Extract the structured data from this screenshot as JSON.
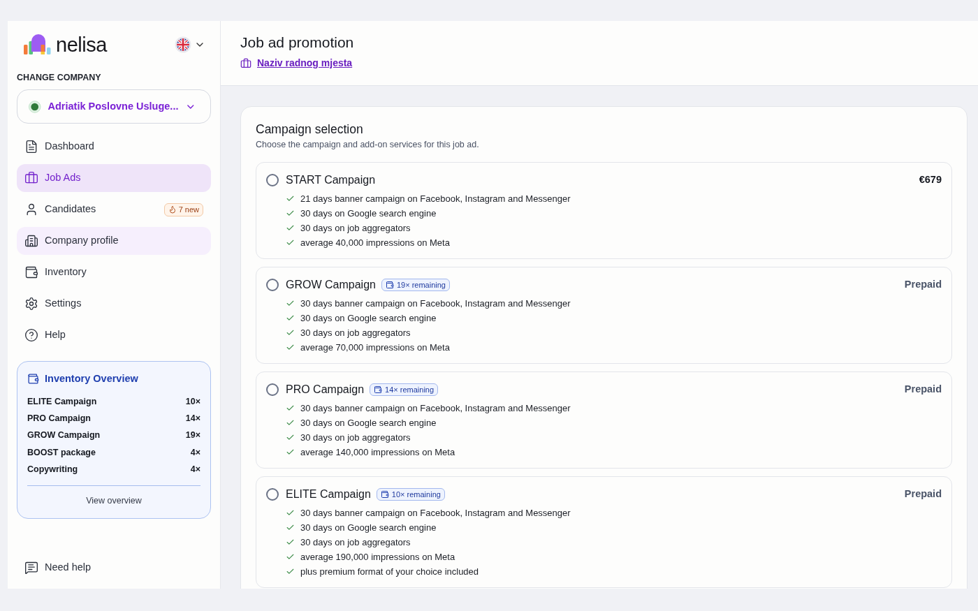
{
  "brand": {
    "name": "nelisa"
  },
  "company_switcher": {
    "label": "CHANGE COMPANY",
    "company": "Adriatik Poslovne Usluge..."
  },
  "nav": [
    {
      "label": "Dashboard",
      "selected": false,
      "hovered": false
    },
    {
      "label": "Job Ads",
      "selected": true,
      "hovered": false
    },
    {
      "label": "Candidates",
      "selected": false,
      "hovered": false,
      "badge": "7 new"
    },
    {
      "label": "Company profile",
      "selected": false,
      "hovered": true
    },
    {
      "label": "Inventory",
      "selected": false,
      "hovered": false
    },
    {
      "label": "Settings",
      "selected": false,
      "hovered": false
    },
    {
      "label": "Help",
      "selected": false,
      "hovered": false
    }
  ],
  "inventory_overview": {
    "title": "Inventory Overview",
    "items": [
      {
        "name": "ELITE Campaign",
        "count": "10×"
      },
      {
        "name": "PRO Campaign",
        "count": "14×"
      },
      {
        "name": "GROW Campaign",
        "count": "19×"
      },
      {
        "name": "BOOST package",
        "count": "4×"
      },
      {
        "name": "Copywriting",
        "count": "4×"
      }
    ],
    "action": "View overview"
  },
  "support": {
    "label": "Need help"
  },
  "header": {
    "title": "Job ad promotion",
    "job_link": "Naziv radnog mjesta"
  },
  "campaign_selection": {
    "title": "Campaign selection",
    "subtitle": "Choose the campaign and add-on services for this job ad.",
    "options": [
      {
        "name": "START Campaign",
        "kind": "paid",
        "selected": false,
        "price": "€679",
        "features": [
          "21 days banner campaign on Facebook, Instagram and Messenger",
          "30 days on Google search engine",
          "30 days on job aggregators",
          "average 40,000 impressions on Meta"
        ]
      },
      {
        "name": "GROW Campaign",
        "kind": "prepaid",
        "selected": false,
        "remaining": "19× remaining",
        "price": "Prepaid",
        "features": [
          "30 days banner campaign on Facebook, Instagram and Messenger",
          "30 days on Google search engine",
          "30 days on job aggregators",
          "average 70,000 impressions on Meta"
        ]
      },
      {
        "name": "PRO Campaign",
        "kind": "prepaid",
        "selected": false,
        "remaining": "14× remaining",
        "price": "Prepaid",
        "features": [
          "30 days banner campaign on Facebook, Instagram and Messenger",
          "30 days on Google search engine",
          "30 days on job aggregators",
          "average 140,000 impressions on Meta"
        ]
      },
      {
        "name": "ELITE Campaign",
        "kind": "prepaid",
        "selected": false,
        "remaining": "10× remaining",
        "price": "Prepaid",
        "features": [
          "30 days banner campaign on Facebook, Instagram and Messenger",
          "30 days on Google search engine",
          "30 days on job aggregators",
          "average 190,000 impressions on Meta",
          "plus premium format of your choice included"
        ]
      }
    ]
  }
}
